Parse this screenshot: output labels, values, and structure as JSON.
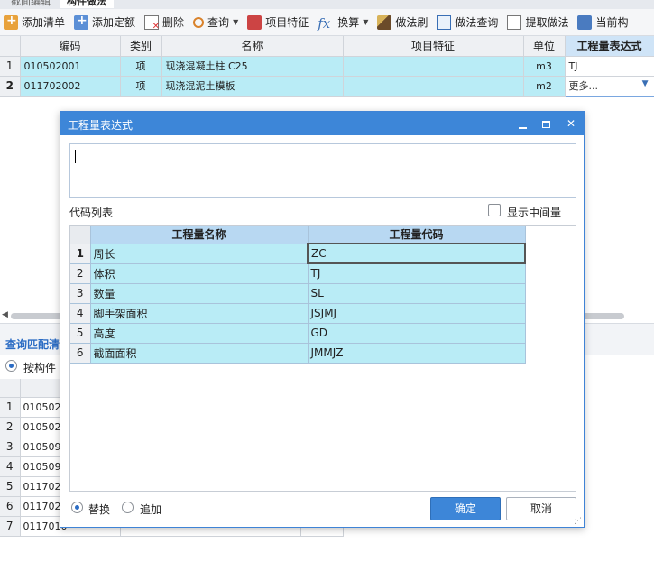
{
  "top_tabs": [
    "截面编辑",
    "构件做法"
  ],
  "toolbar": {
    "items": [
      {
        "label": "添加清单",
        "icon": "add-list-icon"
      },
      {
        "label": "添加定额",
        "icon": "add-quota-icon"
      },
      {
        "label": "删除",
        "icon": "delete-icon"
      },
      {
        "label": "查询",
        "icon": "query-icon",
        "dropdown": true
      },
      {
        "label": "项目特征",
        "icon": "feature-icon"
      },
      {
        "label": "换算",
        "icon": "convert-icon",
        "dropdown": true
      },
      {
        "label": "做法刷",
        "icon": "brush-icon"
      },
      {
        "label": "做法查询",
        "icon": "method-query-icon"
      },
      {
        "label": "提取做法",
        "icon": "extract-icon"
      },
      {
        "label": "当前构",
        "icon": "current-icon"
      }
    ]
  },
  "main_grid": {
    "headers": [
      "编码",
      "类别",
      "名称",
      "项目特征",
      "单位",
      "工程量表达式"
    ],
    "rows": [
      {
        "num": "1",
        "code": "010502001",
        "type": "项",
        "name": "现浇混凝土柱 C25",
        "feature": "",
        "unit": "m3",
        "expr": "TJ"
      },
      {
        "num": "2",
        "code": "011702002",
        "type": "项",
        "name": "现浇混泥土模板",
        "feature": "",
        "unit": "m2",
        "expr": "更多..."
      }
    ]
  },
  "lower": {
    "title": "查询匹配清",
    "radio_label": "按构件",
    "rows": [
      {
        "num": "1",
        "code": "0105020"
      },
      {
        "num": "2",
        "code": "0105020"
      },
      {
        "num": "3",
        "code": "0105090"
      },
      {
        "num": "4",
        "code": "0105090"
      },
      {
        "num": "5",
        "code": "0117020"
      },
      {
        "num": "6",
        "code": "0117020"
      },
      {
        "num": "7",
        "code": "0117010"
      }
    ]
  },
  "dialog": {
    "title": "工程量表达式",
    "expr_value": "",
    "code_list_label": "代码列表",
    "show_mid_label": "显示中间量",
    "show_mid_checked": false,
    "table_headers": [
      "工程量名称",
      "工程量代码"
    ],
    "rows": [
      {
        "num": "1",
        "name": "周长",
        "code": "ZC"
      },
      {
        "num": "2",
        "name": "体积",
        "code": "TJ"
      },
      {
        "num": "3",
        "name": "数量",
        "code": "SL"
      },
      {
        "num": "4",
        "name": "脚手架面积",
        "code": "JSJMJ"
      },
      {
        "num": "5",
        "name": "高度",
        "code": "GD"
      },
      {
        "num": "6",
        "name": "截面面积",
        "code": "JMMJZ"
      }
    ],
    "mode_replace": "替换",
    "mode_append": "追加",
    "mode_selected": "替换",
    "ok_label": "确定",
    "cancel_label": "取消"
  },
  "colors": {
    "accent": "#3d86d8",
    "row_highlight": "#b9ecf6",
    "link": "#2b6cc4"
  }
}
